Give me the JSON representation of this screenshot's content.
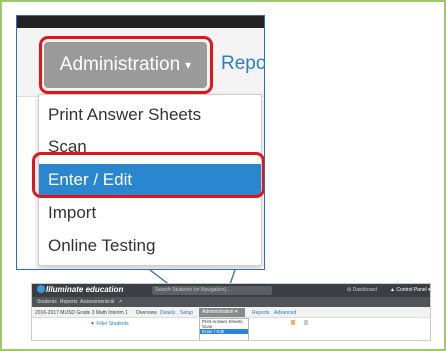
{
  "zoom": {
    "admin_label": "Administration",
    "reports_label": "Repo",
    "menu": [
      "Print Answer Sheets",
      "Scan",
      "Enter / Edit",
      "Import",
      "Online Testing"
    ],
    "active_item": "Enter / Edit"
  },
  "mini": {
    "logo": "Illuminate education",
    "search_placeholder": "Search Students (or Navigation) ..",
    "dashboard": "Dashboard",
    "control_panel": "Control Panel",
    "nav": [
      "Students",
      "Reports",
      "Assessments"
    ],
    "sub_title": "2016-2017 MUSD Grade 3 Math Interim 1",
    "tabs": [
      "Overview",
      "Details",
      "Setup"
    ],
    "admin_label": "Administration",
    "tab_reports": "Reports",
    "tab_advanced": "Advanced",
    "filter": "Filter Students",
    "menu": [
      "Print Answer Sheets",
      "Scan",
      "Enter / Edit"
    ]
  },
  "colors": {
    "highlight": "#e0161c",
    "active": "#2a86cf",
    "link": "#2a7fc2",
    "frame": "#9dc86b",
    "callout": "#2f6db5"
  }
}
